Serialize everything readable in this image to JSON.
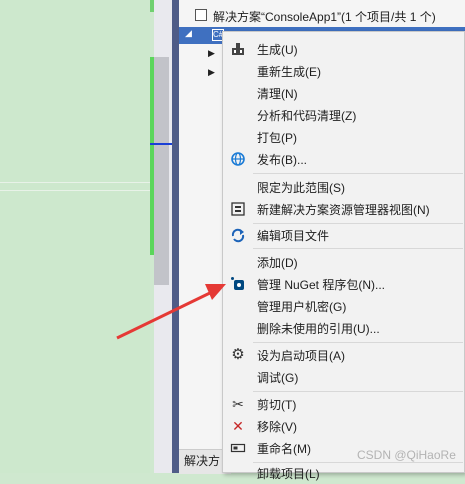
{
  "solution_explorer": {
    "solution_label": "解决方案“ConsoleApp1”(1 个项目/共 1 个)",
    "bottom_tab": "解决方"
  },
  "context_menu": {
    "items": [
      {
        "label": "生成(U)",
        "icon": "build-icon"
      },
      {
        "label": "重新生成(E)",
        "icon": ""
      },
      {
        "label": "清理(N)",
        "icon": ""
      },
      {
        "label": "分析和代码清理(Z)",
        "icon": ""
      },
      {
        "label": "打包(P)",
        "icon": ""
      },
      {
        "label": "发布(B)...",
        "icon": "globe-icon"
      },
      {
        "label": "限定为此范围(S)",
        "icon": ""
      },
      {
        "label": "新建解决方案资源管理器视图(N)",
        "icon": "new-view-icon"
      },
      {
        "label": "编辑项目文件",
        "icon": "edit-project-icon"
      },
      {
        "label": "添加(D)",
        "icon": ""
      },
      {
        "label": "管理 NuGet 程序包(N)...",
        "icon": "nuget-icon"
      },
      {
        "label": "管理用户机密(G)",
        "icon": ""
      },
      {
        "label": "删除未使用的引用(U)...",
        "icon": ""
      },
      {
        "label": "设为启动项目(A)",
        "icon": "gear-icon"
      },
      {
        "label": "调试(G)",
        "icon": ""
      },
      {
        "label": "剪切(T)",
        "icon": "scissors-icon"
      },
      {
        "label": "移除(V)",
        "icon": "remove-icon"
      },
      {
        "label": "重命名(M)",
        "icon": "rename-icon"
      },
      {
        "label": "卸载项目(L)",
        "icon": ""
      }
    ]
  },
  "watermark": "CSDN @QiHaoRe",
  "colors": {
    "selection": "#3f70c0",
    "arrow": "#e53935",
    "editor_bg": "#cde8cd"
  }
}
